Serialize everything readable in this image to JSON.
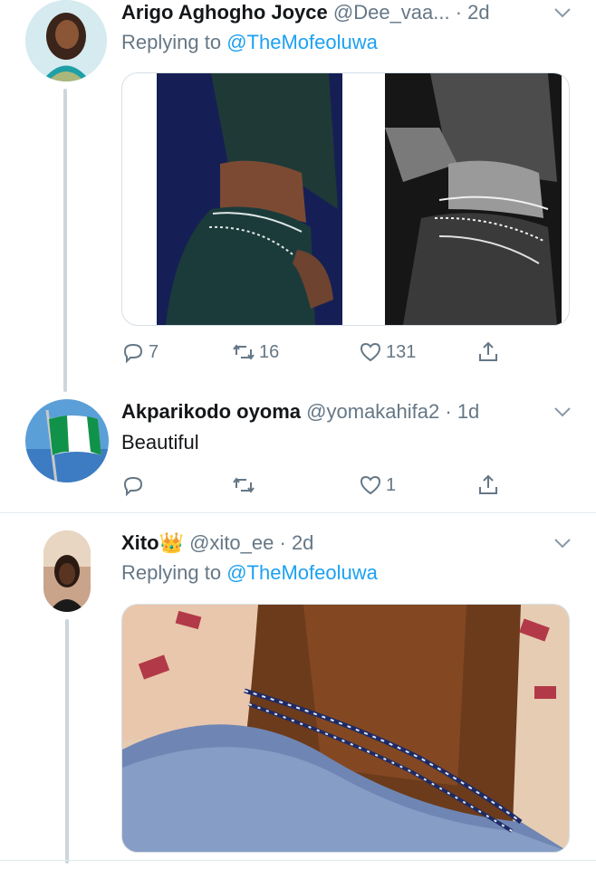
{
  "tweets": [
    {
      "name": "Arigo Aghogho Joyce",
      "handle": "@Dee_vaa...",
      "time": "· 2d",
      "replying_prefix": "Replying to",
      "replying_handle": "@TheMofeoluwa",
      "stats": {
        "replies": "7",
        "retweets": "16",
        "likes": "131"
      }
    },
    {
      "name": "Akparikodo oyoma",
      "handle": "@yomakahifa2",
      "time": "· 1d",
      "text": "Beautiful",
      "stats": {
        "replies": "",
        "retweets": "",
        "likes": "1"
      }
    },
    {
      "name": "Xito",
      "name_emoji": "👑",
      "handle": "@xito_ee",
      "time": "· 2d",
      "replying_prefix": "Replying to",
      "replying_handle": "@TheMofeoluwa"
    }
  ],
  "icons": {
    "reply": "reply-icon",
    "retweet": "retweet-icon",
    "like": "heart-icon",
    "share": "share-icon",
    "more": "chevron-down-icon"
  },
  "colors": {
    "link": "#1da1f2",
    "secondary": "#657786",
    "primary": "#14171a",
    "line": "#ccd6dd"
  }
}
